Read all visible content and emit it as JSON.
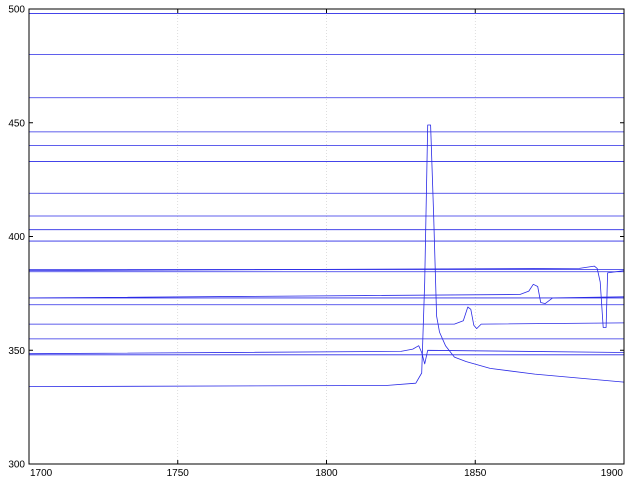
{
  "chart_data": {
    "type": "line",
    "title": "",
    "xlabel": "",
    "ylabel": "",
    "xlim": [
      1700,
      1900
    ],
    "ylim": [
      300,
      500
    ],
    "xticks": [
      1700,
      1750,
      1800,
      1850,
      1900
    ],
    "yticks": [
      300,
      350,
      400,
      450,
      500
    ],
    "grid": true,
    "line_color": "#2a2ae6",
    "grid_color": "#c8c8c8",
    "flat_levels": [
      498,
      480,
      461,
      446,
      440,
      433,
      419,
      409,
      403,
      398,
      385.5,
      384.5,
      373,
      370,
      355,
      348
    ],
    "series": [
      {
        "points": [
          [
            1700,
            334
          ],
          [
            1820,
            334.5
          ],
          [
            1830,
            335.5
          ],
          [
            1832,
            340
          ],
          [
            1833,
            380
          ],
          [
            1834,
            449
          ],
          [
            1835,
            449
          ],
          [
            1836,
            410
          ],
          [
            1837,
            365
          ],
          [
            1838,
            358
          ],
          [
            1840,
            352
          ],
          [
            1843,
            347
          ],
          [
            1847,
            345
          ],
          [
            1855,
            342
          ],
          [
            1870,
            339.5
          ],
          [
            1900,
            336
          ]
        ]
      },
      {
        "points": [
          [
            1700,
            348.5
          ],
          [
            1825,
            349.5
          ],
          [
            1829,
            350.5
          ],
          [
            1831,
            352
          ],
          [
            1832,
            349
          ],
          [
            1833,
            344
          ],
          [
            1834,
            350
          ],
          [
            1900,
            349
          ]
        ]
      },
      {
        "points": [
          [
            1700,
            361.5
          ],
          [
            1843,
            361.5
          ],
          [
            1846,
            363
          ],
          [
            1847.5,
            369
          ],
          [
            1848.5,
            368
          ],
          [
            1849.5,
            361
          ],
          [
            1850.5,
            359.5
          ],
          [
            1852,
            361.5
          ],
          [
            1900,
            362
          ]
        ]
      },
      {
        "points": [
          [
            1700,
            373
          ],
          [
            1865,
            374.5
          ],
          [
            1868,
            376
          ],
          [
            1869.5,
            379
          ],
          [
            1871,
            378
          ],
          [
            1872,
            371
          ],
          [
            1873.5,
            370.5
          ],
          [
            1876,
            373
          ],
          [
            1900,
            373.5
          ]
        ]
      },
      {
        "points": [
          [
            1700,
            385
          ],
          [
            1885,
            386
          ],
          [
            1890,
            387
          ],
          [
            1891,
            386
          ],
          [
            1892,
            380
          ],
          [
            1893,
            360
          ],
          [
            1894,
            360
          ],
          [
            1894.5,
            384
          ],
          [
            1900,
            385
          ]
        ]
      }
    ]
  }
}
